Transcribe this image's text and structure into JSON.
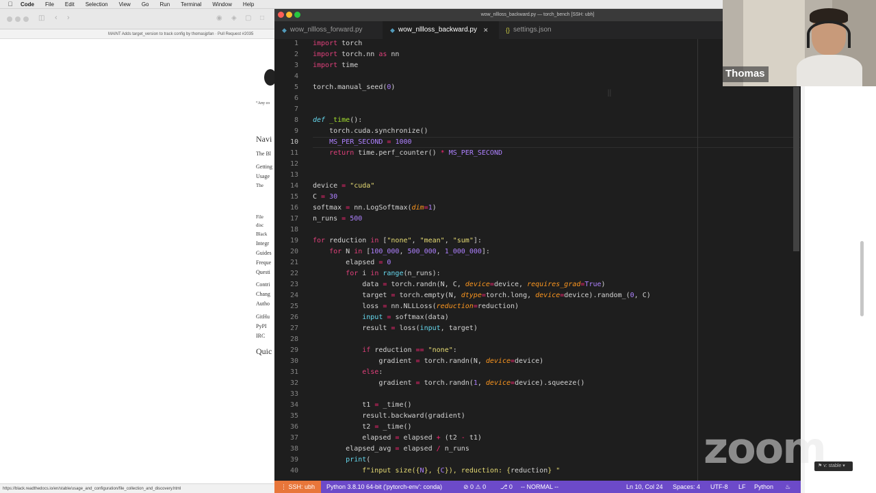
{
  "menubar": {
    "app": "Code",
    "items": [
      "File",
      "Edit",
      "Selection",
      "View",
      "Go",
      "Run",
      "Terminal",
      "Window",
      "Help"
    ]
  },
  "browser": {
    "tab_text": "MAINT Adds target_version to track config by thomasjpfan · Pull Request #2035",
    "nav_items": [
      "“Any co",
      "Navi",
      "The Bl",
      "Getting",
      "Usage",
      "The",
      "File",
      "disc",
      "Black",
      "Integr",
      "Guides",
      "Freque",
      "Questi",
      "Contri",
      "Chang",
      "Autho",
      "GitHu",
      "PyPI",
      "IRC",
      "Quic"
    ],
    "status_url": "https://black.readthedocs.io/en/stable/usage_and_configuration/file_collection_and_discovery.html"
  },
  "vscode": {
    "title": "wow_nllloss_backward.py — torch_bench [SSH: ubh]",
    "tabs": [
      {
        "label": "wow_nllloss_forward.py",
        "icon": "python-file-icon"
      },
      {
        "label": "wow_nllloss_backward.py",
        "icon": "python-file-icon",
        "active": true
      },
      {
        "label": "settings.json",
        "icon": "json-braces-icon"
      }
    ],
    "current_line": 10,
    "line_numbers": [
      "1",
      "2",
      "3",
      "4",
      "5",
      "6",
      "7",
      "8",
      "9",
      "10",
      "11",
      "12",
      "13",
      "14",
      "15",
      "16",
      "17",
      "18",
      "19",
      "20",
      "21",
      "22",
      "23",
      "24",
      "25",
      "26",
      "27",
      "28",
      "29",
      "30",
      "31",
      "32",
      "33",
      "34",
      "35",
      "36",
      "37",
      "38",
      "39",
      "40"
    ],
    "status": {
      "remote": "SSH: ubh",
      "interpreter": "Python 3.8.10 64-bit ('pytorch-env': conda)",
      "problems": "⊘ 0 ⚠ 0",
      "ports": "⎇ 0",
      "vim_mode": "-- NORMAL --",
      "position": "Ln 10, Col 24",
      "spaces": "Spaces: 4",
      "encoding": "UTF-8",
      "eol": "LF",
      "language": "Python"
    }
  },
  "zoom": {
    "participant_name": "Thomas",
    "watermark": "zoom",
    "badge": "v: stable"
  },
  "colors": {
    "editor_bg": "#1e1e1e",
    "statusbar": "#6c4ac9",
    "remote_badge": "#e8763a"
  }
}
